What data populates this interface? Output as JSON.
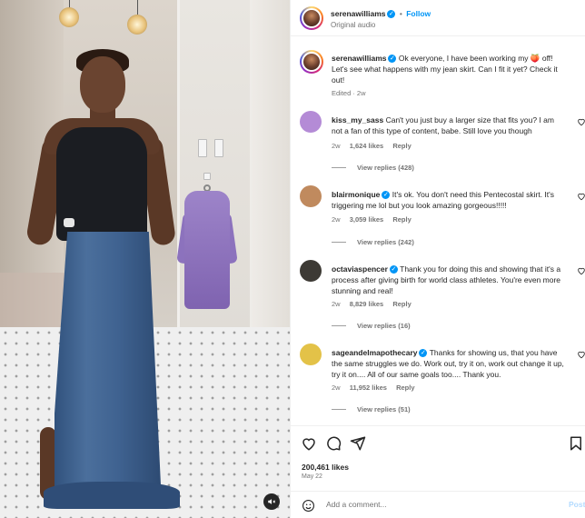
{
  "post": {
    "author": "serenawilliams",
    "follow_label": "Follow",
    "audio": "Original audio",
    "caption": "Ok everyone, I have been working my 🍑 off! Let's see what happens with my jean skirt. Can I fit it yet? Check it out!",
    "caption_meta": "Edited · 2w",
    "likes": "200,461 likes",
    "date": "May 22",
    "add_comment_placeholder": "Add a comment...",
    "post_label": "Post"
  },
  "comments": [
    {
      "user": "kiss_my_sass",
      "verified": false,
      "text": "Can't you just buy a larger size that fits you? I am not a fan of this type of content, babe. Still love you though",
      "age": "2w",
      "likes": "1,624 likes",
      "reply": "Reply",
      "view_replies": "View replies (428)",
      "avatar_color": "#b48bd6"
    },
    {
      "user": "blairmonique",
      "verified": true,
      "text": "It's ok. You don't need this Pentecostal skirt. It's triggering me lol but you look amazing gorgeous!!!!!",
      "age": "2w",
      "likes": "3,059 likes",
      "reply": "Reply",
      "view_replies": "View replies (242)",
      "avatar_color": "#c08a5e"
    },
    {
      "user": "octaviaspencer",
      "verified": true,
      "text": "Thank you for doing this and showing that it's a process after giving birth for world class athletes. You're even more stunning and real!",
      "age": "2w",
      "likes": "8,829 likes",
      "reply": "Reply",
      "view_replies": "View replies (16)",
      "avatar_color": "#3d3a35"
    },
    {
      "user": "sageandelmapothecary",
      "verified": true,
      "text": "Thanks for showing us, that you have the same struggles we do. Work out, try it on, work out change it up, try it on.... All of our same goals too.... Thank you.",
      "age": "2w",
      "likes": "11,952 likes",
      "reply": "Reply",
      "view_replies": "View replies (51)",
      "avatar_color": "#e3c248"
    }
  ],
  "icons": {
    "like": "heart-icon",
    "comment": "comment-icon",
    "share": "share-icon",
    "save": "bookmark-icon",
    "emoji": "emoji-icon",
    "mute": "muted-speaker-icon"
  },
  "colors": {
    "accent": "#0095f6",
    "text": "#262626",
    "muted": "#737373",
    "post_disabled": "#b3dbff"
  }
}
